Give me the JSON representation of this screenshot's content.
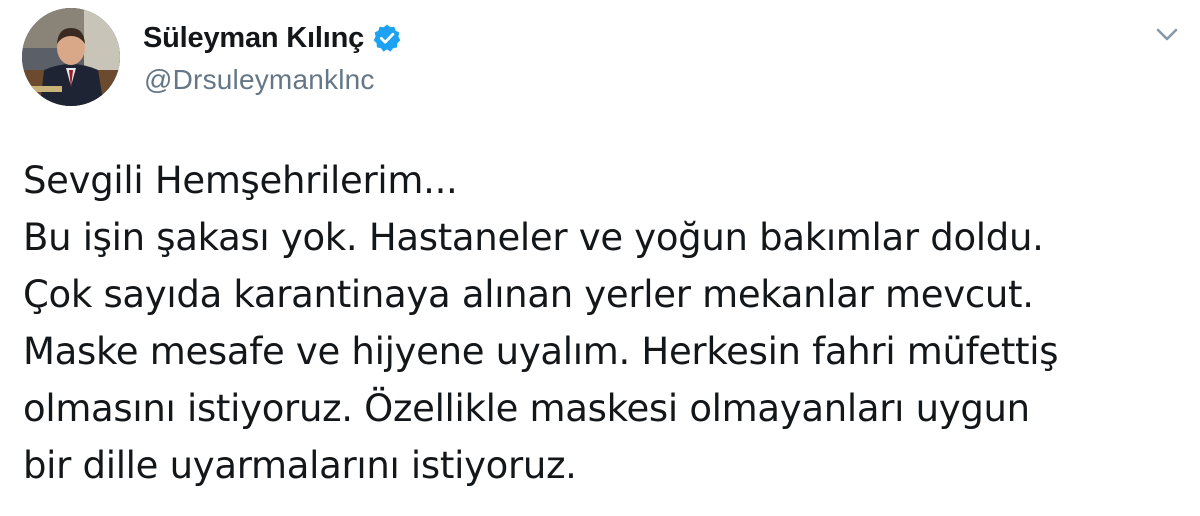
{
  "author": {
    "display_name": "Süleyman Kılınç",
    "handle": "@Drsuleymanklnc",
    "verified": true,
    "avatar": "profile-photo"
  },
  "menu": {
    "icon": "chevron-down-icon"
  },
  "tweet": {
    "lines": [
      "Sevgili Hemşehrilerim...",
      "Bu işin şakası yok. Hastaneler ve yoğun bakımlar doldu.",
      "Çok sayıda karantinaya alınan yerler mekanlar mevcut.",
      "Maske mesafe ve hijyene uyalım. Herkesin fahri müfettiş",
      "olmasını istiyoruz. Özellikle maskesi olmayanları uygun",
      "bir dille uyarmalarını istiyoruz."
    ]
  },
  "colors": {
    "verified_badge": "#1da1f2",
    "handle": "#657786",
    "text": "#14171a",
    "caret": "#8899a6"
  }
}
